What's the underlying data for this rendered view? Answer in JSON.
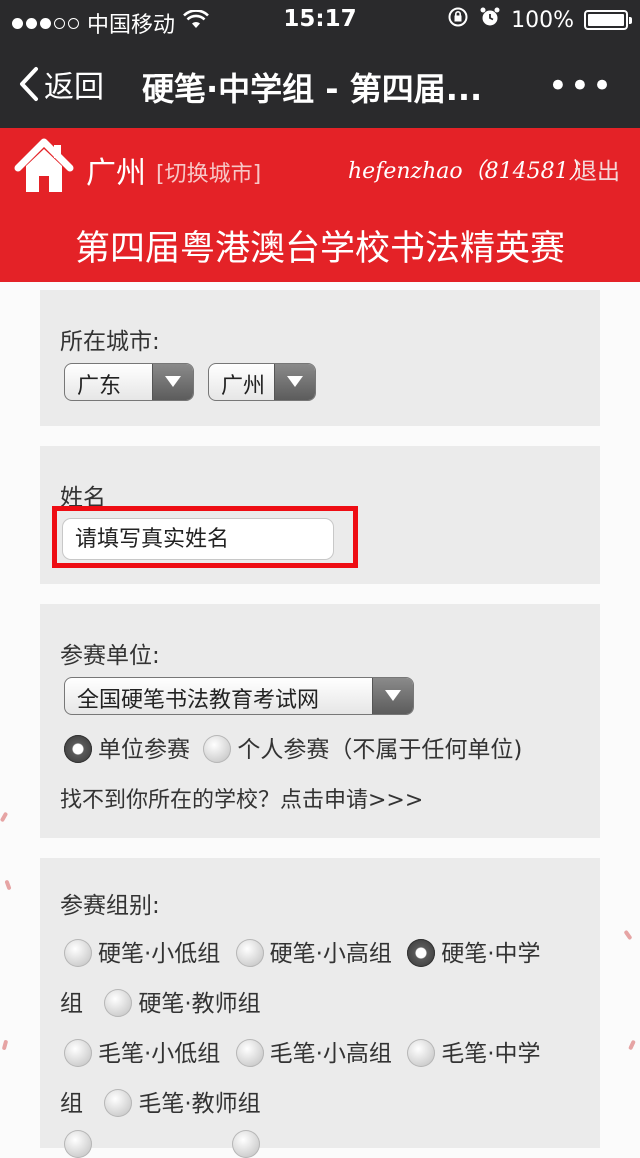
{
  "status_bar": {
    "carrier": "中国移动",
    "time": "15:17",
    "battery": "100%",
    "battery_level": 1.0,
    "signal_bars": 3,
    "signal_total": 5
  },
  "nav": {
    "back_label": "返回",
    "title": "硬笔·中学组 - 第四届...",
    "more": "•••"
  },
  "header": {
    "city": "广州",
    "switch_city": "[切换城市]",
    "user": "hefenzhao（814581）",
    "logout": "退出",
    "banner": "第四届粤港澳台学校书法精英赛"
  },
  "form": {
    "city_label": "所在城市:",
    "province_select": "广东",
    "city_select": "广州",
    "name_label": "姓名",
    "name_placeholder": "请填写真实姓名",
    "name_value": "",
    "unit_label": "参赛单位:",
    "unit_select": "全国硬笔书法教育考试网",
    "unit_option_1": "单位参赛",
    "unit_option_2": "个人参赛（不属于任何单位)",
    "unit_selected": "单位参赛",
    "apply_link": "找不到你所在的学校？点击申请>>>",
    "group_label": "参赛组别:",
    "groups": {
      "g1": "硬笔·小低组",
      "g2": "硬笔·小高组",
      "g3a": "硬笔·中学",
      "g3b": "组",
      "g4": "硬笔·教师组",
      "g5": "毛笔·小低组",
      "g6": "毛笔·小高组",
      "g7a": "毛笔·中学",
      "g7b": "组",
      "g8": "毛笔·教师组"
    },
    "group_selected": "硬笔·中学组"
  },
  "colors": {
    "header_red": "#e42227",
    "dark_bar": "#2a2a2c",
    "highlight_red": "#ee0d14",
    "panel_bg": "#ebebeb"
  }
}
